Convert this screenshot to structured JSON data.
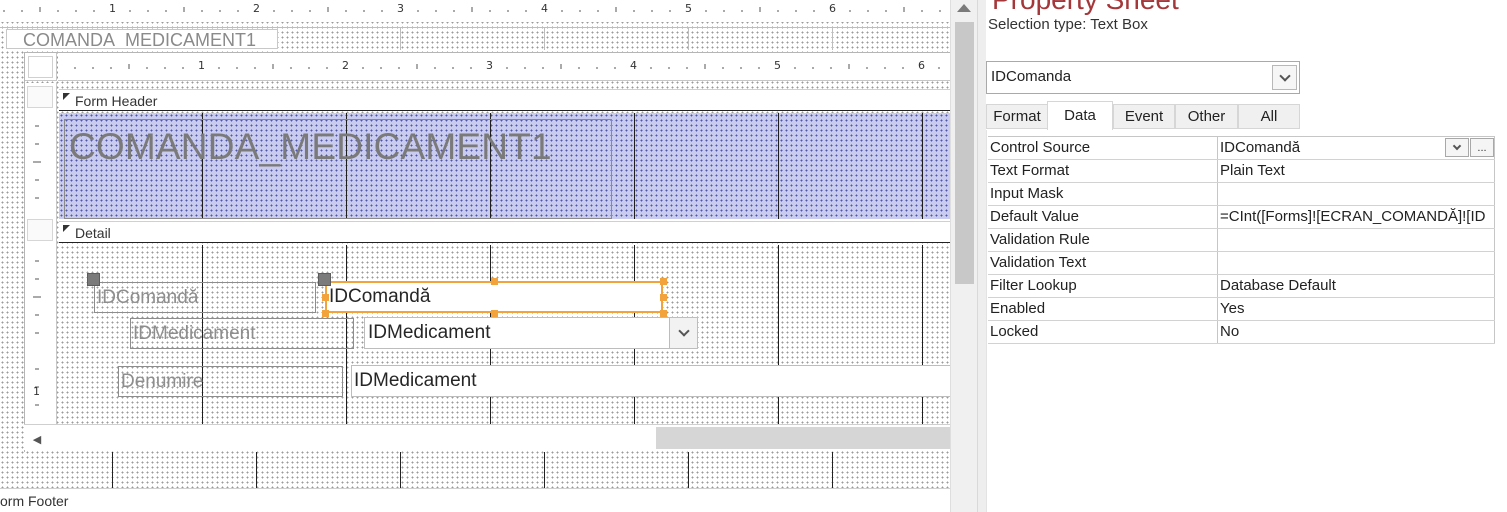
{
  "design": {
    "ruler_numbers": [
      "1",
      "2",
      "3",
      "4",
      "5",
      "6"
    ],
    "outer_caption": "COMANDA_MEDICAMENT1",
    "form_header_label": "Form Header",
    "detail_label": "Detail",
    "form_footer_label": "orm Footer",
    "header_title": "COMANDA_MEDICAMENT1",
    "vertical_ruler_number": "1",
    "controls": {
      "idcomanda_label": "IDComandă",
      "idcomanda_textbox": "IDComandă",
      "idmedicament_label": "IDMedicament",
      "idmedicament_combo": "IDMedicament",
      "denumire_label": "Denumire",
      "denumire_textbox": "IDMedicament"
    }
  },
  "property_sheet": {
    "title": "Property Sheet",
    "selection_type": "Selection type:  Text Box",
    "selected_object": "IDComanda",
    "tabs": [
      "Format",
      "Data",
      "Event",
      "Other",
      "All"
    ],
    "active_tab": "Data",
    "properties": [
      {
        "name": "Control Source",
        "value": "IDComandă"
      },
      {
        "name": "Text Format",
        "value": "Plain Text"
      },
      {
        "name": "Input Mask",
        "value": ""
      },
      {
        "name": "Default Value",
        "value": "=CInt([Forms]![ECRAN_COMANDĂ]![ID"
      },
      {
        "name": "Validation Rule",
        "value": ""
      },
      {
        "name": "Validation Text",
        "value": ""
      },
      {
        "name": "Filter Lookup",
        "value": "Database Default"
      },
      {
        "name": "Enabled",
        "value": "Yes"
      },
      {
        "name": "Locked",
        "value": "No"
      }
    ],
    "build_button": "..."
  },
  "colors": {
    "selection_orange": "#f2a33b",
    "header_band": "#c9cbef",
    "title_red": "#a4373a"
  }
}
